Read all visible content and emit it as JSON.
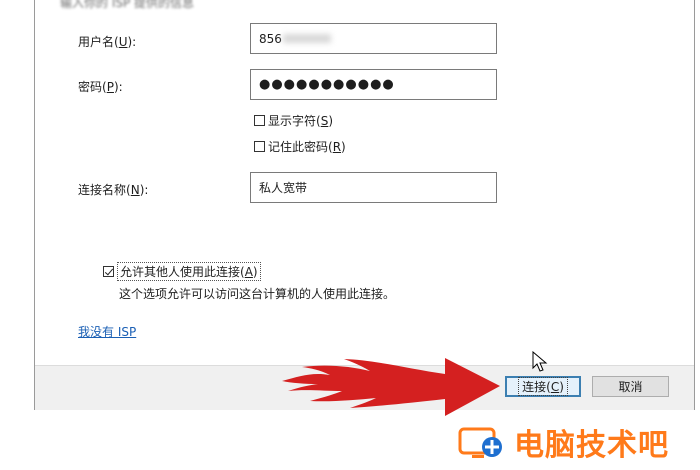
{
  "dialog": {
    "top_partial_text": "输入你的 ISP 提供的信息",
    "username_label": "用户名",
    "username_hotkey": "U",
    "username_value": "856",
    "password_label": "密码",
    "password_hotkey": "P",
    "password_value": "●●●●●●●●●●●",
    "show_chars_label": "显示字符",
    "show_chars_hotkey": "S",
    "show_chars_checked": false,
    "remember_label": "记住此密码",
    "remember_hotkey": "R",
    "remember_checked": false,
    "conn_name_label": "连接名称",
    "conn_name_hotkey": "N",
    "conn_name_value": "私人宽带",
    "allow_others_label": "允许其他人使用此连接",
    "allow_others_hotkey": "A",
    "allow_others_checked": true,
    "allow_others_desc": "这个选项允许可以访问这台计算机的人使用此连接。",
    "no_isp_link": "我没有 ISP",
    "connect_label": "连接",
    "connect_hotkey": "C",
    "cancel_label": "取消"
  },
  "watermark": {
    "text": "电脑技术吧",
    "icon": "tech-logo-icon",
    "color": "#ff7a1a"
  },
  "colors": {
    "arrow": "#d42020",
    "primary_border": "#3c7fb1",
    "link": "#1a5fb4"
  }
}
